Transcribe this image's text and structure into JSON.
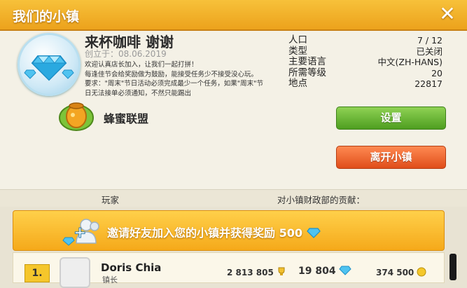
{
  "window": {
    "title": "我们的小镇",
    "close_glyph": "✕"
  },
  "town": {
    "name": "来杯咖啡 谢谢",
    "founded": "创立于：08.06.2019",
    "description": [
      "欢迎认真店长加入，让我们一起打拼！",
      "每逢佳节会给奖励做为鼓励，能接受任务少不接受没心玩。",
      "要求：\"周末\"节日活动必须完成最少一个任务，如果\"周末\"节",
      "日无法接单必须通知，不然只能踢出"
    ],
    "alliance": "蜂蜜联盟"
  },
  "stats": [
    {
      "label": "人口",
      "value": "7 / 12"
    },
    {
      "label": "类型",
      "value": "已关闭"
    },
    {
      "label": "主要语言",
      "value": "中文(ZH-HANS)"
    },
    {
      "label": "所需等级",
      "value": "20"
    },
    {
      "label": "地点",
      "value": "22817"
    }
  ],
  "buttons": {
    "settings": "设置",
    "leave": "离开小镇"
  },
  "columns": {
    "player": "玩家",
    "contribution": "对小镇财政部的贡献："
  },
  "invite": {
    "text": "邀请好友加入您的小镇并获得奖励 500"
  },
  "members": [
    {
      "rank": "1.",
      "name": "Doris Chia",
      "role": "镇长",
      "trophies": "2 813 805",
      "diamonds": "19 804",
      "coins": "374 500"
    }
  ],
  "colors": {
    "title_bar": "#f1b02a",
    "settings_button": "#5fae2c",
    "leave_button": "#ef6a35",
    "invite_banner": "#f8bb2a"
  }
}
